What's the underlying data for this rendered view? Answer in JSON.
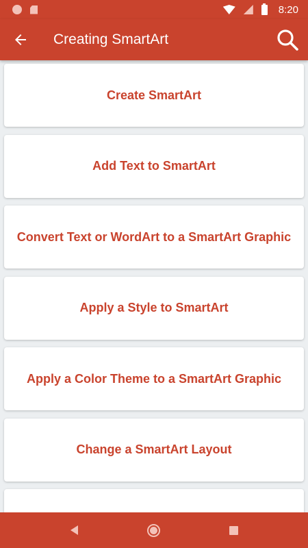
{
  "status_bar": {
    "time": "8:20",
    "icons": [
      "notification-dot-icon",
      "sd-card-icon",
      "wifi-icon",
      "signal-icon",
      "battery-icon"
    ]
  },
  "app_bar": {
    "title": "Creating SmartArt",
    "back_icon": "arrow-left-icon",
    "search_icon": "search-icon"
  },
  "items": [
    {
      "label": "Create SmartArt"
    },
    {
      "label": "Add Text to SmartArt"
    },
    {
      "label": "Convert Text or WordArt to a SmartArt Graphic"
    },
    {
      "label": "Apply a Style to SmartArt"
    },
    {
      "label": "Apply a Color Theme to a SmartArt Graphic"
    },
    {
      "label": "Change a SmartArt Layout"
    },
    {
      "label": ""
    }
  ],
  "nav_bar": {
    "buttons": [
      "nav-back-icon",
      "nav-home-icon",
      "nav-recent-icon"
    ]
  },
  "colors": {
    "primary": "#c9432d",
    "background": "#eceff1",
    "card": "#ffffff"
  }
}
